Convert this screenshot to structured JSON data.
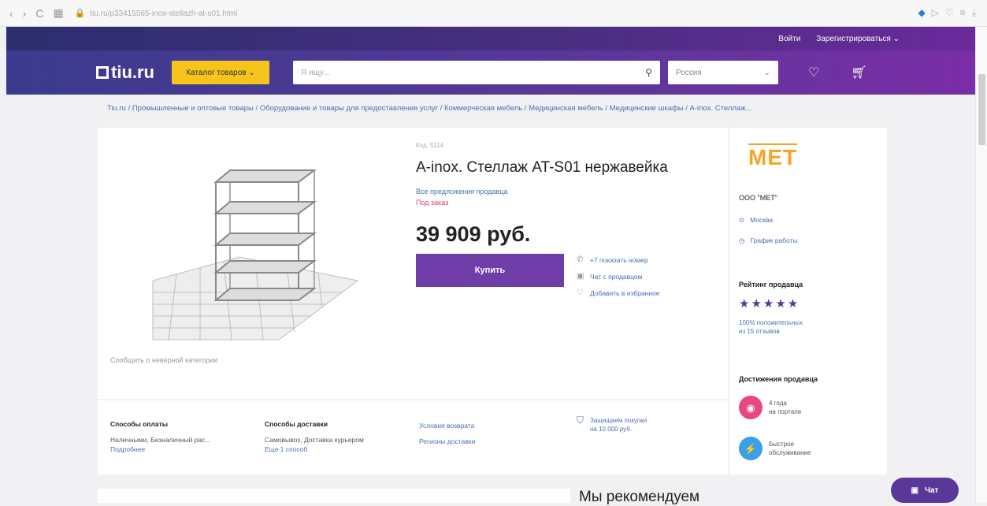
{
  "browser": {
    "nav": [
      "‹",
      "›",
      "C",
      "▦"
    ],
    "url": "tiu.ru/p33415565-inox-stellazh-at-s01.html"
  },
  "topbar": {
    "login": "Войти",
    "register": "Зарегистрироваться ⌄"
  },
  "header": {
    "logo": "tiu.ru",
    "catalog": "Каталог товаров ⌄",
    "search_placeholder": "Я ищу...",
    "region": "Россия",
    "region_arrow": "⌄"
  },
  "breadcrumb": "Tiu.ru / Промышленные и оптовые товары / Оборудование и товары для предоставления услуг / Коммерческая мебель / Медицинская мебель / Медицинские шкафы / A-inox. Стеллаж...",
  "product": {
    "code": "Код: 5114",
    "title": "A-inox. Стеллаж AT-S01 нержавейка",
    "all_offers": "Все предложения продавца",
    "availability": "Под заказ",
    "price": "39 909 руб.",
    "buy": "Купить",
    "actions": [
      {
        "icon": "phone-icon",
        "glyph": "✆",
        "label": "+7 показать номер"
      },
      {
        "icon": "chat-icon",
        "glyph": "▣",
        "label": "Чат с продавцом"
      },
      {
        "icon": "heart-icon",
        "glyph": "♡",
        "label": "Добавить в избранное"
      }
    ],
    "report": "Сообщить о неверной категории"
  },
  "bottom": {
    "payment_h": "Способы оплаты",
    "payment_t": "Наличными, Безналичный рас...",
    "payment_more": "Подробнее",
    "delivery_h": "Способы доставки",
    "delivery_t": "Самовывоз, Доставка курьером",
    "delivery_more": "Еще 1 способ",
    "return_link": "Условия возврата",
    "regions_link": "Регионы доставки",
    "protect_1": "Защищаем покупки",
    "protect_2": "на 10 000 руб."
  },
  "seller": {
    "logo": "MET",
    "name": "ООО \"МЕТ\"",
    "city": "Москва",
    "schedule": "График работы",
    "rating_h": "Рейтинг продавца",
    "stars": "★★★★★",
    "positive_1": "100% положительных",
    "positive_2": "из 15 отзывов",
    "ach_h": "Достижения продавца",
    "ach": [
      {
        "line1": "4 года",
        "line2": "на портале",
        "color": "#e8487c",
        "glyph": "◉"
      },
      {
        "line1": "Быстрое",
        "line2": "обслуживание",
        "color": "#3aa0e6",
        "glyph": "⚡"
      }
    ]
  },
  "recommend": "Мы рекомендуем",
  "chat": "Чат"
}
